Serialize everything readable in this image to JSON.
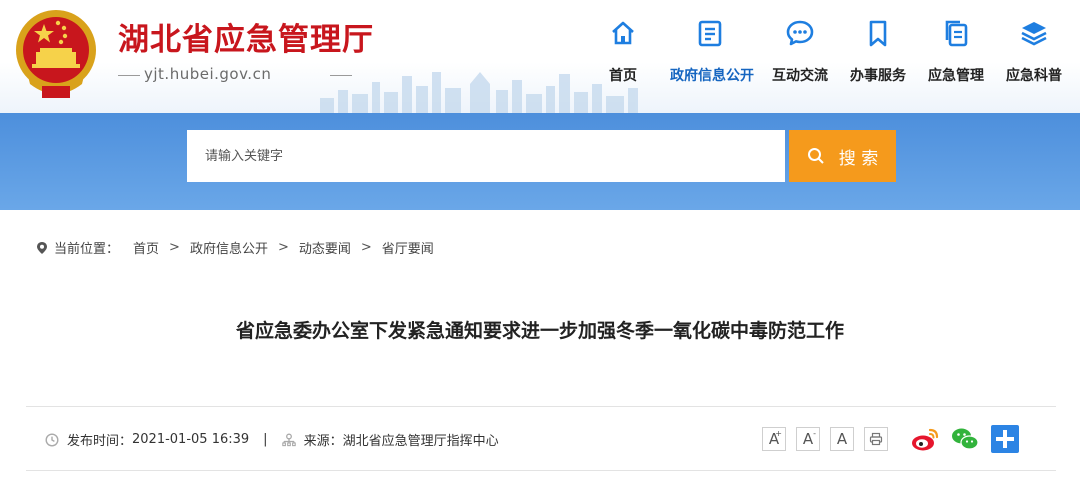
{
  "site": {
    "title": "湖北省应急管理厅",
    "domain": "yjt.hubei.gov.cn"
  },
  "nav": [
    {
      "label": "首页",
      "icon": "home-icon"
    },
    {
      "label": "政府信息公开",
      "icon": "document-icon",
      "active": true
    },
    {
      "label": "互动交流",
      "icon": "chat-bubble-icon"
    },
    {
      "label": "办事服务",
      "icon": "bookmark-icon"
    },
    {
      "label": "应急管理",
      "icon": "files-icon"
    },
    {
      "label": "应急科普",
      "icon": "layers-icon"
    }
  ],
  "search": {
    "placeholder": "请输入关键字",
    "button_label": "搜 索"
  },
  "breadcrumb": {
    "prefix": "当前位置：",
    "items": [
      "首页",
      "政府信息公开",
      "动态要闻",
      "省厅要闻"
    ]
  },
  "article": {
    "title": "省应急委办公室下发紧急通知要求进一步加强冬季一氧化碳中毒防范工作",
    "published_label": "发布时间：",
    "published": "2021-01-05 16:39",
    "source_label": "来源：",
    "source": "湖北省应急管理厅指挥中心"
  },
  "font_buttons": {
    "larger": "A",
    "smaller": "A",
    "normal": "A",
    "larger_mark": "+",
    "smaller_mark": "-"
  },
  "colors": {
    "brand_red": "#c8161d",
    "nav_blue": "#1565c0",
    "band_blue": "#5c9be0",
    "search_orange": "#f59a1c"
  }
}
